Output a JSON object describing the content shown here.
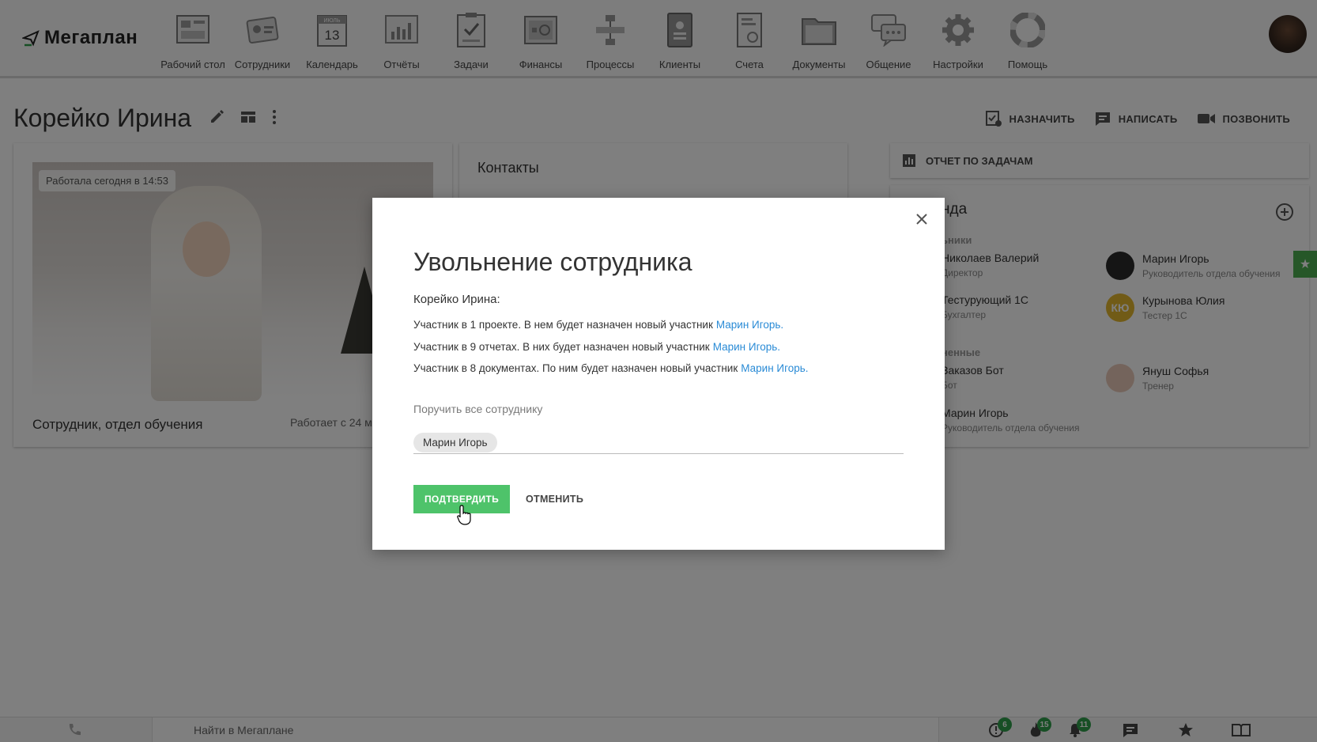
{
  "app": {
    "logo": "Мегаплан"
  },
  "nav": [
    {
      "label": "Рабочий стол",
      "icon": "desktop-icon"
    },
    {
      "label": "Сотрудники",
      "icon": "employees-icon"
    },
    {
      "label": "Календарь",
      "icon": "calendar-icon",
      "cal_month": "ИЮЛЬ",
      "cal_day": "13"
    },
    {
      "label": "Отчёты",
      "icon": "reports-icon"
    },
    {
      "label": "Задачи",
      "icon": "tasks-icon"
    },
    {
      "label": "Финансы",
      "icon": "finance-icon"
    },
    {
      "label": "Процессы",
      "icon": "processes-icon"
    },
    {
      "label": "Клиенты",
      "icon": "clients-icon"
    },
    {
      "label": "Счета",
      "icon": "invoices-icon"
    },
    {
      "label": "Документы",
      "icon": "documents-icon"
    },
    {
      "label": "Общение",
      "icon": "chat-icon"
    },
    {
      "label": "Настройки",
      "icon": "settings-icon"
    },
    {
      "label": "Помощь",
      "icon": "help-icon"
    }
  ],
  "page": {
    "title": "Корейко Ирина",
    "actions": {
      "assign": "НАЗНАЧИТЬ",
      "write": "НАПИСАТЬ",
      "call": "ПОЗВОНИТЬ"
    }
  },
  "profile": {
    "badge": "Работала сегодня в 14:53",
    "role": "Сотрудник, отдел обучения",
    "since": "Работает с 24 м"
  },
  "contacts": {
    "title": "Контакты"
  },
  "task_report": {
    "label": "ОТЧЕТ ПО ЗАДАЧАМ"
  },
  "team": {
    "title": "нда",
    "section_heads": "ьники",
    "section_subs": "ненные",
    "members": [
      {
        "name": "Николаев Валерий",
        "role": "Директор"
      },
      {
        "name": "Марин Игорь",
        "role": "Руководитель отдела обучения"
      },
      {
        "name": "Тестурующий 1С",
        "role": "Бухгалтер"
      },
      {
        "name": "Курынова Юлия",
        "role": "Тестер 1С",
        "initials": "КЮ"
      },
      {
        "name": "Заказов Бот",
        "role": "Бот"
      },
      {
        "name": "Януш Софья",
        "role": "Тренер"
      },
      {
        "name": "Марин Игорь",
        "role": "Руководитель отдела обучения"
      }
    ]
  },
  "bottom": {
    "search_placeholder": "Найти в Мегаплане",
    "badges": {
      "alerts": "6",
      "hot": "15",
      "notifications": "11"
    }
  },
  "modal": {
    "title": "Увольнение сотрудника",
    "subject": "Корейко Ирина:",
    "lines": [
      {
        "text": "Участник в 1 проекте. В нем будет назначен новый участник",
        "link": "Марин Игорь."
      },
      {
        "text": "Участник в 9 отчетах. В них будет назначен новый участник",
        "link": "Марин Игорь."
      },
      {
        "text": "Участник в 8 документах. По ним будет назначен новый участник",
        "link": "Марин Игорь."
      }
    ],
    "assign_all": "Поручить все сотруднику",
    "chip": "Марин Игорь",
    "confirm": "ПОДТВЕРДИТЬ",
    "cancel": "ОТМЕНИТЬ"
  },
  "colors": {
    "accent": "#4ec36a",
    "link": "#2a8bd6",
    "badge": "#2e9e4a"
  }
}
